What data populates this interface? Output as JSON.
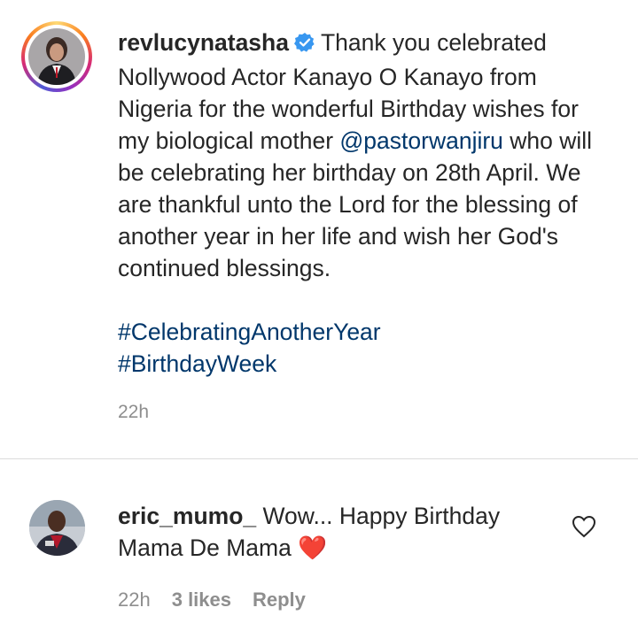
{
  "post": {
    "username": "revlucynatasha",
    "verified_icon": "verified-badge-icon",
    "text_before_mention": "Thank you celebrated Nollywood Actor Kanayo O Kanayo from Nigeria for the wonderful Birthday wishes for my biological mother",
    "mention": "@pastorwanjiru",
    "text_after_mention": "who will be celebrating her birthday on 28th April. We are thankful unto the Lord for the blessing of another year in her life and wish her God's continued blessings.",
    "hashtags": [
      "#CelebratingAnotherYear",
      "#BirthdayWeek"
    ],
    "time": "22h"
  },
  "comment": {
    "username": "eric_mumo_",
    "text": "Wow... Happy Birthday Mama De Mama",
    "emoji": "❤️",
    "time": "22h",
    "likes": "3 likes",
    "reply_label": "Reply",
    "like_icon": "heart-outline-icon"
  },
  "colors": {
    "link": "#00376b",
    "meta": "#8e8e8e",
    "text": "#262626",
    "verified": "#3897f0"
  }
}
